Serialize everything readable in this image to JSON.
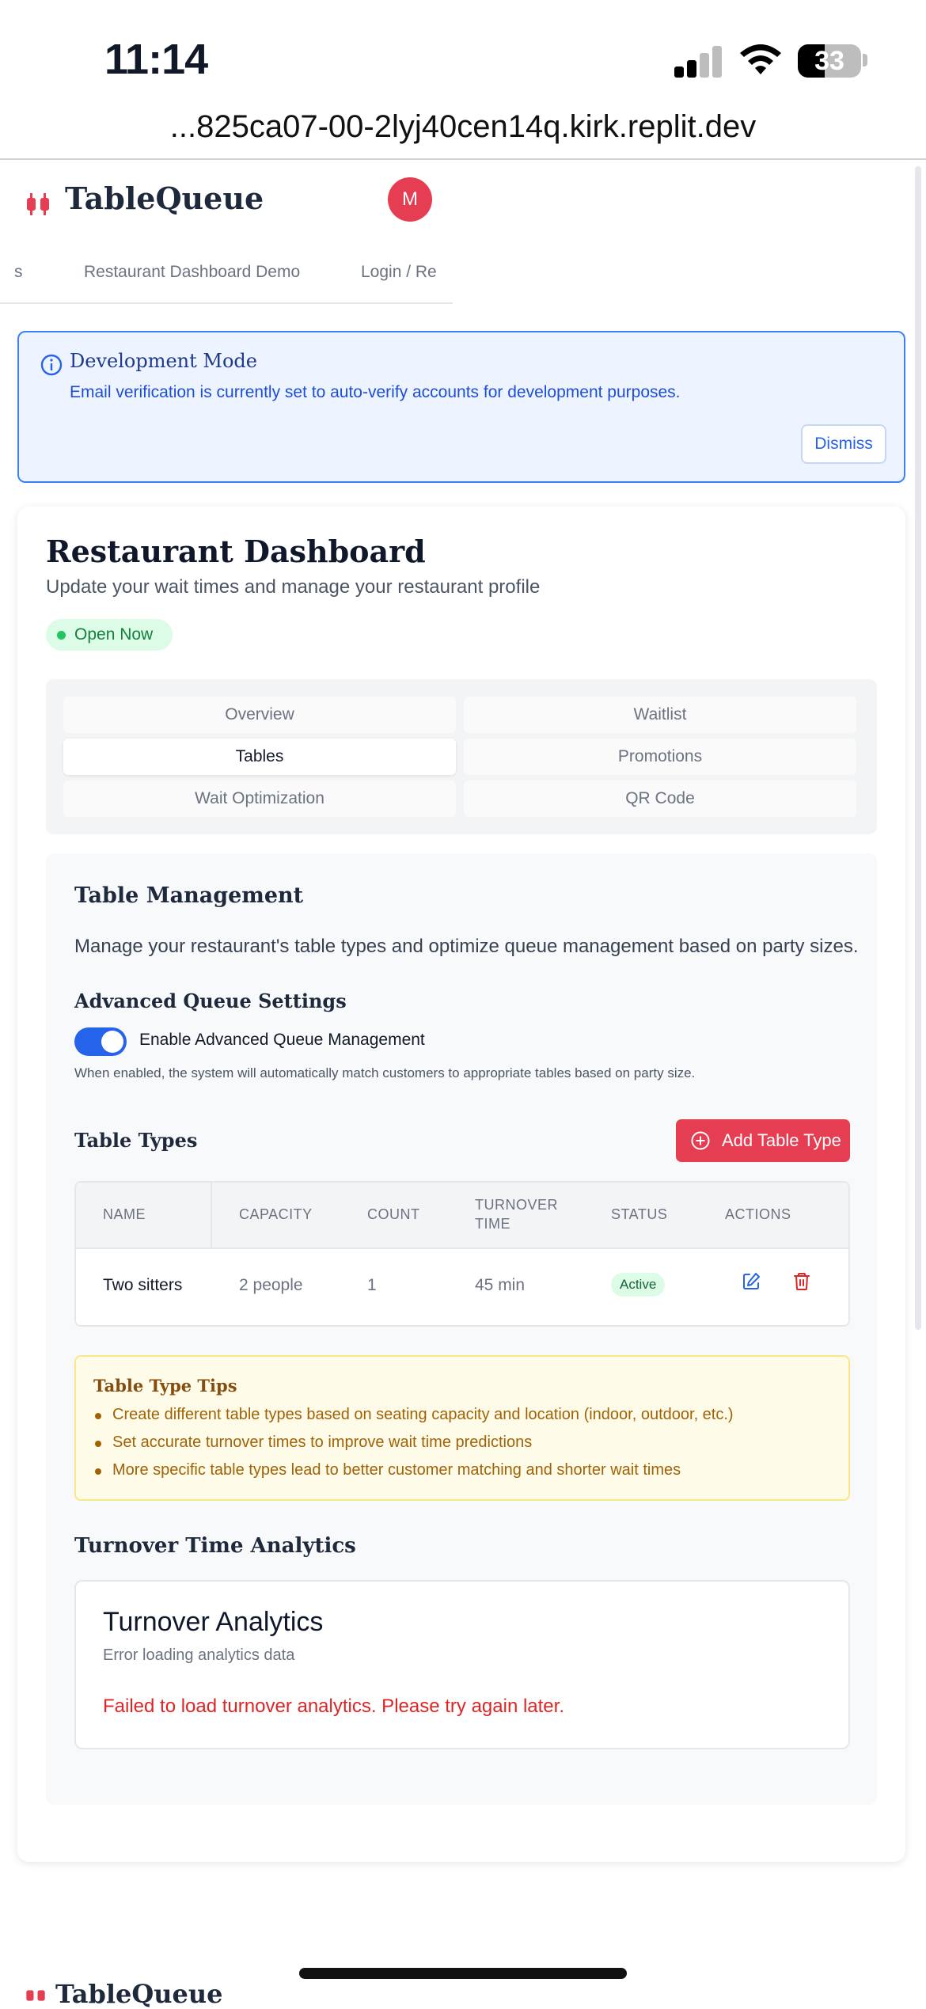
{
  "status_bar": {
    "time": "11:14",
    "battery": "33"
  },
  "browser": {
    "url": "...825ca07-00-2lyj40cen14q.kirk.replit.dev"
  },
  "header": {
    "app_name": "TableQueue",
    "avatar_initial": "M",
    "nav": [
      "s",
      "Restaurant Dashboard Demo",
      "Login / Re"
    ]
  },
  "dev_banner": {
    "title": "Development Mode",
    "text": "Email verification is currently set to auto-verify accounts for development purposes.",
    "dismiss_label": "Dismiss"
  },
  "dashboard": {
    "title": "Restaurant Dashboard",
    "subtitle": "Update your wait times and manage your restaurant profile",
    "status_badge": "Open Now",
    "tabs": [
      {
        "label": "Overview"
      },
      {
        "label": "Waitlist"
      },
      {
        "label": "Tables"
      },
      {
        "label": "Promotions"
      },
      {
        "label": "Wait Optimization"
      },
      {
        "label": "QR Code"
      }
    ],
    "active_tab": "Tables"
  },
  "table_management": {
    "title": "Table Management",
    "description": "Manage your restaurant's table types and optimize queue management based on party sizes.",
    "advanced_title": "Advanced Queue Settings",
    "toggle_label": "Enable Advanced Queue Management",
    "toggle_on": true,
    "toggle_help": "When enabled, the system will automatically match customers to appropriate tables based on party size.",
    "table_types_title": "Table Types",
    "add_button": "Add Table Type",
    "columns": [
      "NAME",
      "CAPACITY",
      "COUNT",
      "TURNOVER",
      "TIME",
      "STATUS",
      "ACTIONS"
    ],
    "rows": [
      {
        "name": "Two sitters",
        "capacity": "2 people",
        "count": "1",
        "turnover": "45 min",
        "status": "Active"
      }
    ],
    "tips_title": "Table Type Tips",
    "tips": [
      "Create different table types based on seating capacity and location (indoor, outdoor, etc.)",
      "Set accurate turnover times to improve wait time predictions",
      "More specific table types lead to better customer matching and shorter wait times"
    ],
    "analytics_section_title": "Turnover Time Analytics",
    "analytics_card_title": "Turnover Analytics",
    "analytics_card_sub": "Error loading analytics data",
    "analytics_error": "Failed to load turnover analytics. Please try again later."
  },
  "footer": {
    "app_name": "TableQueue"
  },
  "colors": {
    "brand": "#e53e52",
    "primary": "#2563eb",
    "success": "#22c55e",
    "warning": "#a16207",
    "error": "#dc2626"
  },
  "icons": [
    "signal-icon",
    "wifi-icon",
    "battery-icon",
    "logo-icon",
    "info-icon",
    "plus-circle-icon",
    "edit-icon",
    "trash-icon"
  ]
}
